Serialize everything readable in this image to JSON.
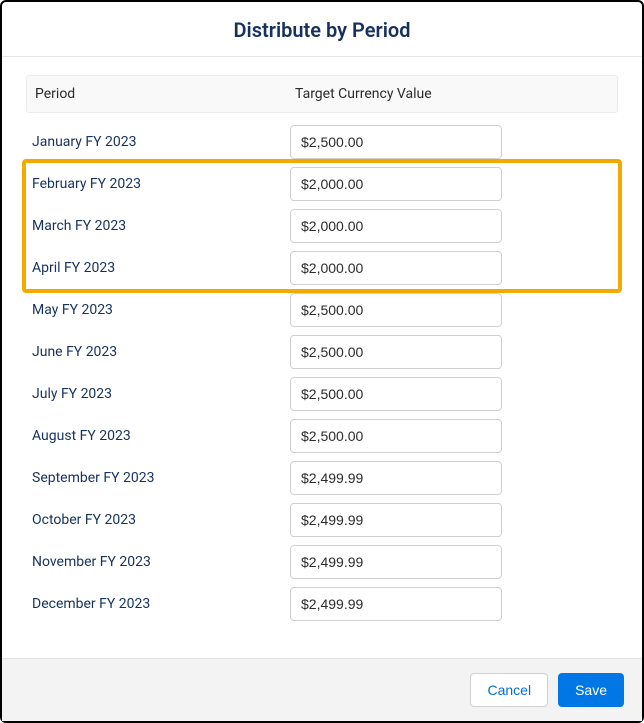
{
  "dialog": {
    "title": "Distribute by Period"
  },
  "table": {
    "headers": {
      "period": "Period",
      "value": "Target Currency Value"
    },
    "rows": [
      {
        "period": "January FY 2023",
        "value": "$2,500.00",
        "highlighted": false
      },
      {
        "period": "February FY 2023",
        "value": "$2,000.00",
        "highlighted": true
      },
      {
        "period": "March FY 2023",
        "value": "$2,000.00",
        "highlighted": true
      },
      {
        "period": "April FY 2023",
        "value": "$2,000.00",
        "highlighted": true
      },
      {
        "period": "May FY 2023",
        "value": "$2,500.00",
        "highlighted": false
      },
      {
        "period": "June FY 2023",
        "value": "$2,500.00",
        "highlighted": false
      },
      {
        "period": "July FY 2023",
        "value": "$2,500.00",
        "highlighted": false
      },
      {
        "period": "August FY 2023",
        "value": "$2,500.00",
        "highlighted": false
      },
      {
        "period": "September FY 2023",
        "value": "$2,499.99",
        "highlighted": false
      },
      {
        "period": "October FY 2023",
        "value": "$2,499.99",
        "highlighted": false
      },
      {
        "period": "November FY 2023",
        "value": "$2,499.99",
        "highlighted": false
      },
      {
        "period": "December FY 2023",
        "value": "$2,499.99",
        "highlighted": false
      }
    ]
  },
  "footer": {
    "cancel": "Cancel",
    "save": "Save"
  },
  "colors": {
    "highlight": "#f2a900",
    "primary": "#0077e5"
  }
}
